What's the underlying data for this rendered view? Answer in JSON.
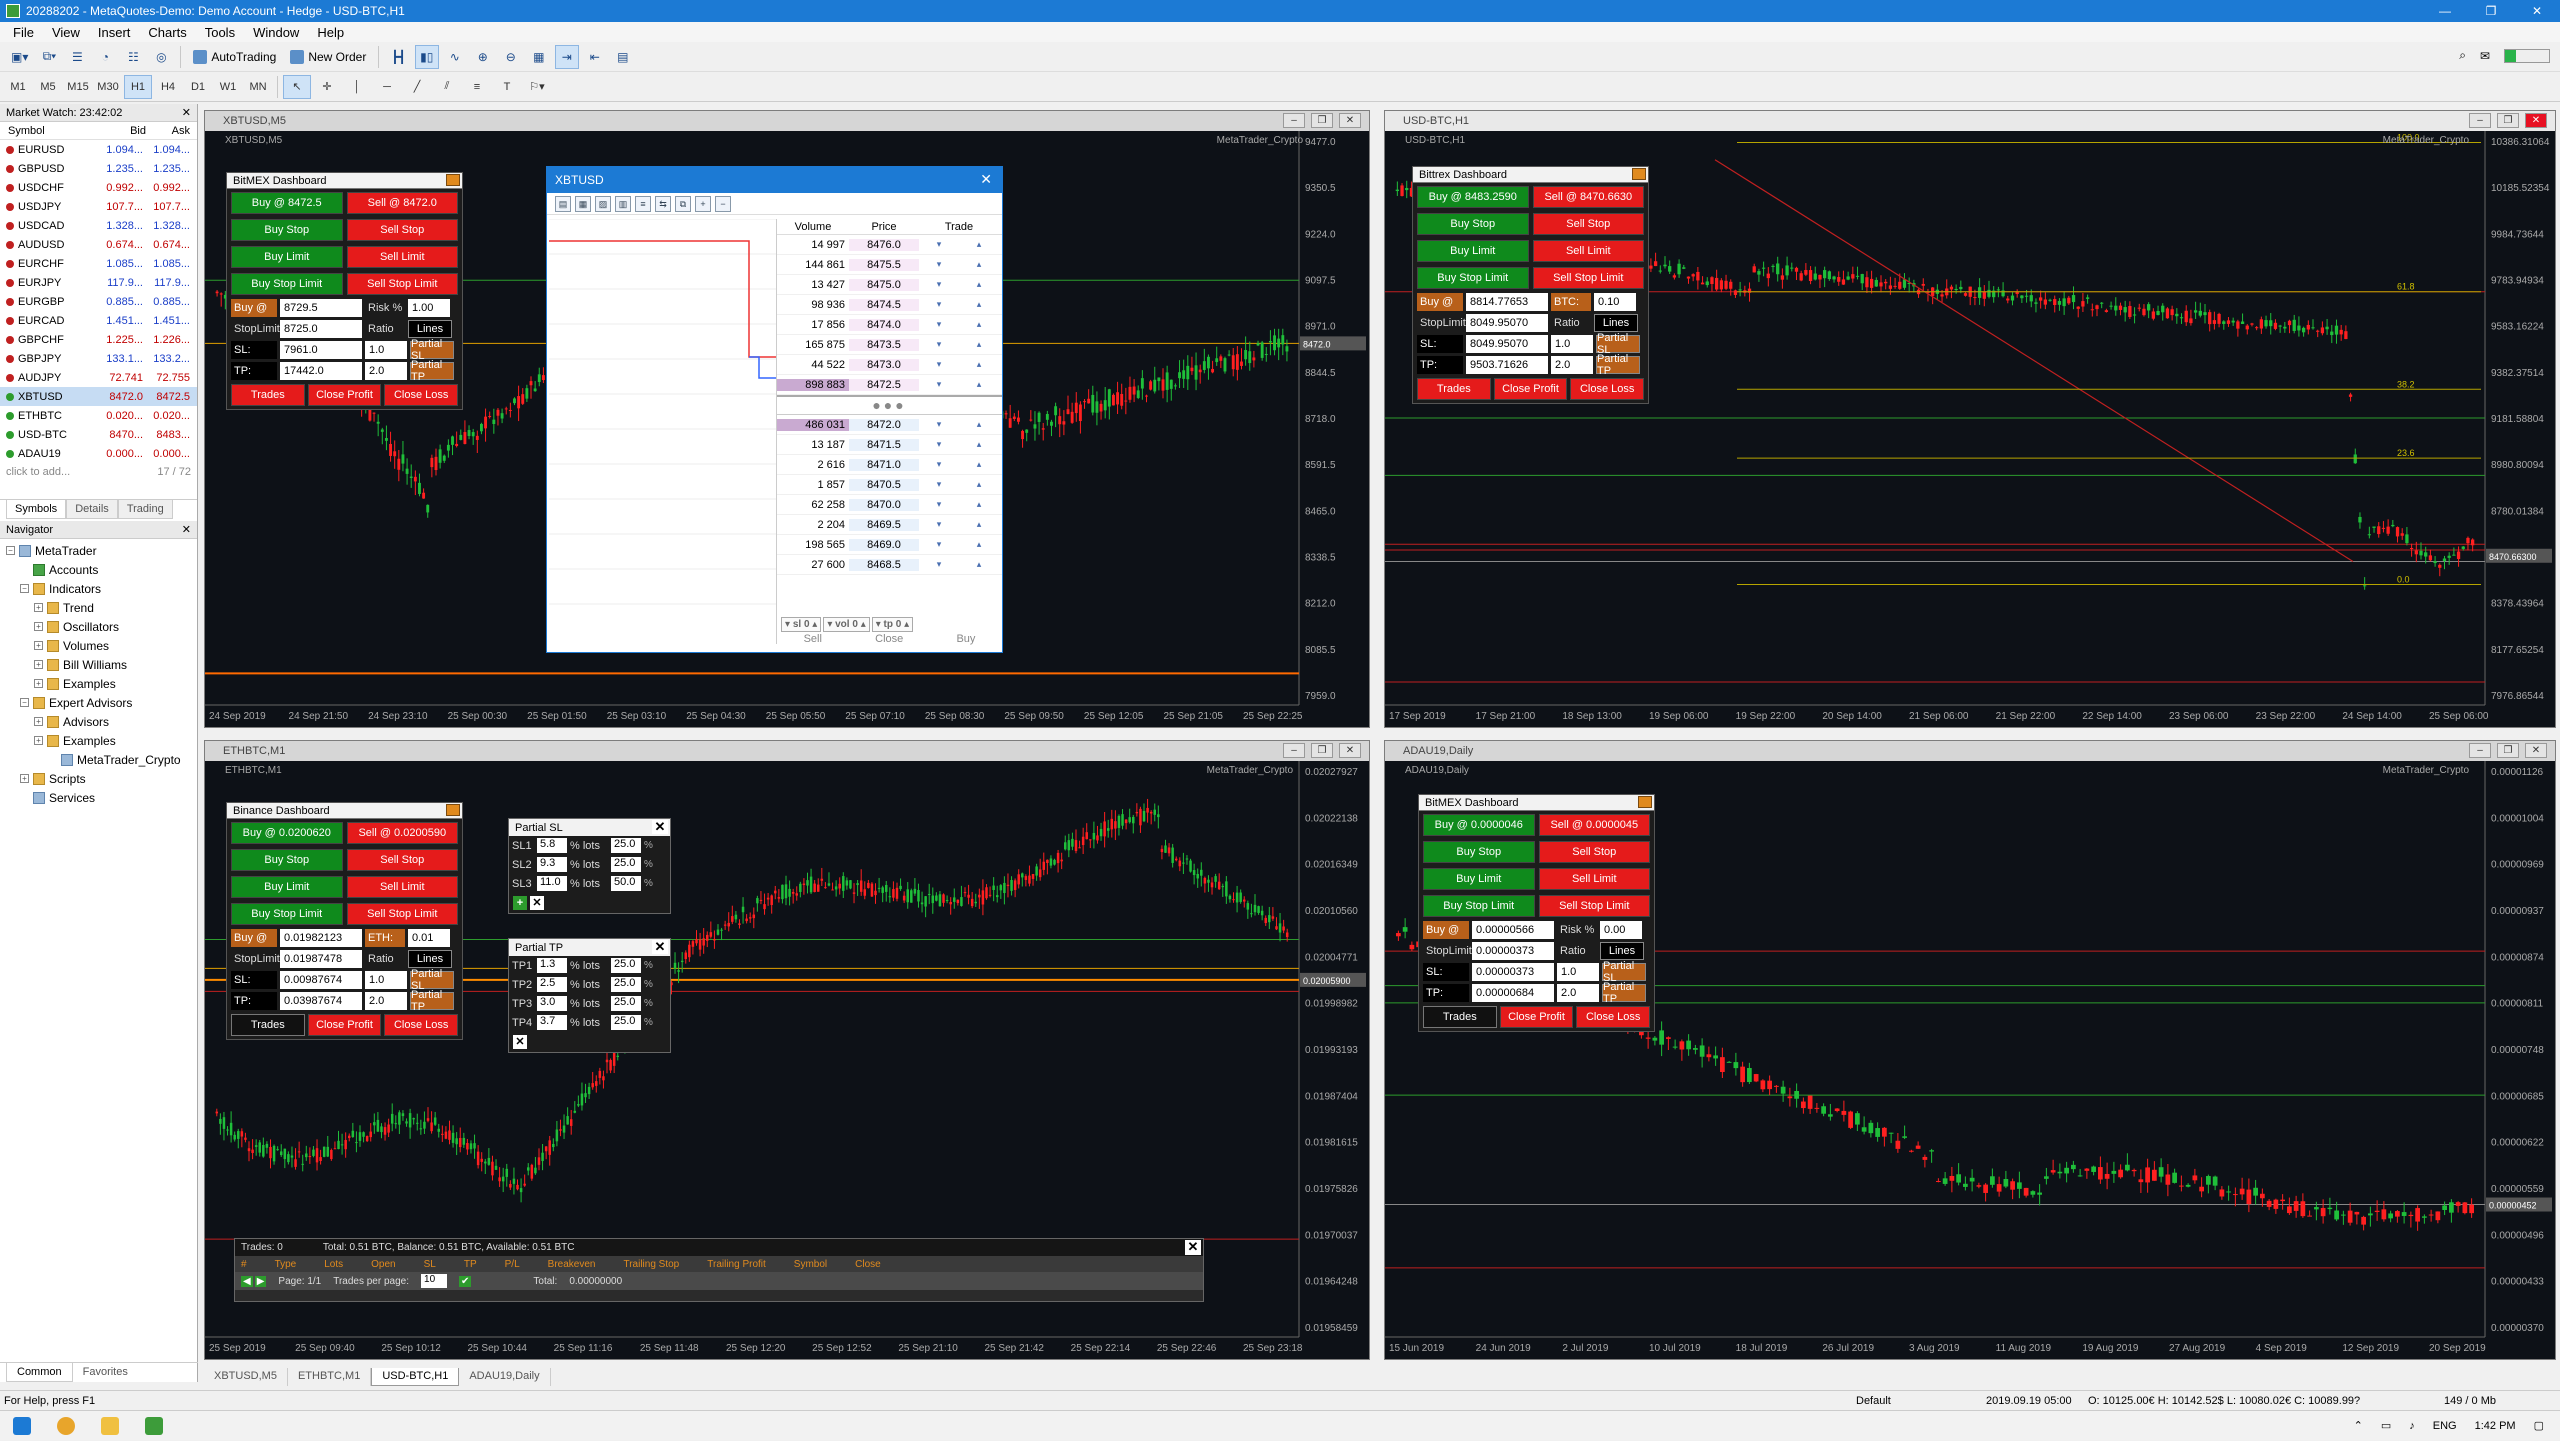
{
  "window": {
    "title": "20288202 - MetaQuotes-Demo: Demo Account - Hedge - USD-BTC,H1"
  },
  "menu": [
    "File",
    "View",
    "Insert",
    "Charts",
    "Tools",
    "Window",
    "Help"
  ],
  "toolbar": {
    "autotrading": "AutoTrading",
    "new_order": "New Order"
  },
  "timeframes": [
    "M1",
    "M5",
    "M15",
    "M30",
    "H1",
    "H4",
    "D1",
    "W1",
    "MN"
  ],
  "market_watch": {
    "title": "Market Watch: 23:42:02",
    "cols": [
      "Symbol",
      "Bid",
      "Ask"
    ],
    "rows": [
      {
        "s": "EURUSD",
        "b": "1.094...",
        "a": "1.094..."
      },
      {
        "s": "GBPUSD",
        "b": "1.235...",
        "a": "1.235..."
      },
      {
        "s": "USDCHF",
        "b": "0.992...",
        "a": "0.992..."
      },
      {
        "s": "USDJPY",
        "b": "107.7...",
        "a": "107.7..."
      },
      {
        "s": "USDCAD",
        "b": "1.328...",
        "a": "1.328..."
      },
      {
        "s": "AUDUSD",
        "b": "0.674...",
        "a": "0.674..."
      },
      {
        "s": "EURCHF",
        "b": "1.085...",
        "a": "1.085..."
      },
      {
        "s": "EURJPY",
        "b": "117.9...",
        "a": "117.9..."
      },
      {
        "s": "EURGBP",
        "b": "0.885...",
        "a": "0.885..."
      },
      {
        "s": "EURCAD",
        "b": "1.451...",
        "a": "1.451..."
      },
      {
        "s": "GBPCHF",
        "b": "1.225...",
        "a": "1.226..."
      },
      {
        "s": "GBPJPY",
        "b": "133.1...",
        "a": "133.2..."
      },
      {
        "s": "AUDJPY",
        "b": "72.741",
        "a": "72.755"
      },
      {
        "s": "XBTUSD",
        "b": "8472.0",
        "a": "8472.5"
      },
      {
        "s": "ETHBTC",
        "b": "0.020...",
        "a": "0.020..."
      },
      {
        "s": "USD-BTC",
        "b": "8470...",
        "a": "8483..."
      },
      {
        "s": "ADAU19",
        "b": "0.000...",
        "a": "0.000..."
      }
    ],
    "add": "click to add...",
    "count": "17 / 72",
    "tabs": [
      "Symbols",
      "Details",
      "Trading"
    ]
  },
  "navigator": {
    "title": "Navigator",
    "items": [
      "MetaTrader",
      "Accounts",
      "Indicators",
      "Trend",
      "Oscillators",
      "Volumes",
      "Bill Williams",
      "Examples",
      "Expert Advisors",
      "Advisors",
      "Examples",
      "MetaTrader_Crypto",
      "Scripts",
      "Services"
    ],
    "tabs": [
      "Common",
      "Favorites"
    ]
  },
  "charts": [
    {
      "id": "XBTUSD,M5",
      "sub": "XBTUSD,M5",
      "brand": "MetaTrader_Crypto",
      "prices": [
        "9477.0",
        "9350.5",
        "9224.0",
        "9097.5",
        "8971.0",
        "8844.5",
        "8718.0",
        "8591.5",
        "8465.0",
        "8338.5",
        "8212.0",
        "8085.5",
        "7959.0"
      ],
      "times": [
        "24 Sep 2019",
        "24 Sep 21:50",
        "24 Sep 23:10",
        "25 Sep 00:30",
        "25 Sep 01:50",
        "25 Sep 03:10",
        "25 Sep 04:30",
        "25 Sep 05:50",
        "25 Sep 07:10",
        "25 Sep 08:30",
        "25 Sep 09:50",
        "25 Sep 12:05",
        "25 Sep 21:05",
        "25 Sep 22:25"
      ],
      "price_tag": "8472.0"
    },
    {
      "id": "USD-BTC,H1",
      "sub": "USD-BTC,H1",
      "brand": "MetaTrader_Crypto",
      "prices": [
        "10386.31064",
        "10185.52354",
        "9984.73644",
        "9783.94934",
        "9583.16224",
        "9382.37514",
        "9181.58804",
        "8980.80094",
        "8780.01384",
        "8579.22674",
        "8378.43964",
        "8177.65254",
        "7976.86544"
      ],
      "times": [
        "17 Sep 2019",
        "17 Sep 21:00",
        "18 Sep 13:00",
        "19 Sep 06:00",
        "19 Sep 22:00",
        "20 Sep 14:00",
        "21 Sep 06:00",
        "21 Sep 22:00",
        "22 Sep 14:00",
        "23 Sep 06:00",
        "23 Sep 22:00",
        "24 Sep 14:00",
        "25 Sep 06:00"
      ],
      "fib": [
        "100.0",
        "61.8",
        "38.2",
        "23.6",
        "0.0"
      ],
      "price_tag": "8470.66300"
    },
    {
      "id": "ETHBTC,M1",
      "sub": "ETHBTC,M1",
      "brand": "MetaTrader_Crypto",
      "prices": [
        "0.02027927",
        "0.02022138",
        "0.02016349",
        "0.02010560",
        "0.02004771",
        "0.01998982",
        "0.01993193",
        "0.01987404",
        "0.01981615",
        "0.01975826",
        "0.01970037",
        "0.01964248",
        "0.01958459"
      ],
      "times": [
        "25 Sep 2019",
        "25 Sep 09:40",
        "25 Sep 10:12",
        "25 Sep 10:44",
        "25 Sep 11:16",
        "25 Sep 11:48",
        "25 Sep 12:20",
        "25 Sep 12:52",
        "25 Sep 21:10",
        "25 Sep 21:42",
        "25 Sep 22:14",
        "25 Sep 22:46",
        "25 Sep 23:18"
      ],
      "price_tag": "0.02005900"
    },
    {
      "id": "ADAU19,Daily",
      "sub": "ADAU19,Daily",
      "brand": "MetaTrader_Crypto",
      "prices": [
        "0.00001126",
        "0.00001004",
        "0.00000969",
        "0.00000937",
        "0.00000874",
        "0.00000811",
        "0.00000748",
        "0.00000685",
        "0.00000622",
        "0.00000559",
        "0.00000496",
        "0.00000433",
        "0.00000370"
      ],
      "times": [
        "15 Jun 2019",
        "24 Jun 2019",
        "2 Jul 2019",
        "10 Jul 2019",
        "18 Jul 2019",
        "26 Jul 2019",
        "3 Aug 2019",
        "11 Aug 2019",
        "19 Aug 2019",
        "27 Aug 2019",
        "4 Sep 2019",
        "12 Sep 2019",
        "20 Sep 2019"
      ],
      "price_tag": "0.00000452"
    }
  ],
  "dashboards": [
    {
      "title": "BitMEX Dashboard",
      "buy": "Buy @ 8472.5",
      "sell": "Sell @ 8472.0",
      "buy_stop": "Buy Stop",
      "sell_stop": "Sell Stop",
      "buy_limit": "Buy Limit",
      "sell_limit": "Sell Limit",
      "buy_stop_limit": "Buy Stop Limit",
      "sell_stop_limit": "Sell Stop Limit",
      "buy_at": "Buy @",
      "buy_at_val": "8729.5",
      "risk_lbl": "Risk %",
      "risk_val": "1.00",
      "stoplimit_lbl": "StopLimit",
      "stoplimit_val": "8725.0",
      "ratio": "Ratio",
      "lines": "Lines",
      "sl_lbl": "SL:",
      "sl_val": "7961.0",
      "sl_r": "1.0",
      "partial_sl": "Partial SL",
      "tp_lbl": "TP:",
      "tp_val": "17442.0",
      "tp_r": "2.0",
      "partial_tp": "Partial TP",
      "trades": "Trades",
      "close_profit": "Close Profit",
      "close_loss": "Close Loss"
    },
    {
      "title": "Bittrex Dashboard",
      "buy": "Buy @ 8483.2590",
      "sell": "Sell @ 8470.6630",
      "buy_stop": "Buy Stop",
      "sell_stop": "Sell Stop",
      "buy_limit": "Buy Limit",
      "sell_limit": "Sell Limit",
      "buy_stop_limit": "Buy Stop Limit",
      "sell_stop_limit": "Sell Stop Limit",
      "buy_at": "Buy @",
      "buy_at_val": "8814.77653",
      "risk_lbl": "BTC:",
      "risk_val": "0.10",
      "stoplimit_lbl": "StopLimit",
      "stoplimit_val": "8049.95070",
      "ratio": "Ratio",
      "lines": "Lines",
      "sl_lbl": "SL:",
      "sl_val": "8049.95070",
      "sl_r": "1.0",
      "partial_sl": "Partial SL",
      "tp_lbl": "TP:",
      "tp_val": "9503.71626",
      "tp_r": "2.0",
      "partial_tp": "Partial TP",
      "trades": "Trades",
      "close_profit": "Close Profit",
      "close_loss": "Close Loss"
    },
    {
      "title": "Binance Dashboard",
      "buy": "Buy @ 0.0200620",
      "sell": "Sell @ 0.0200590",
      "buy_stop": "Buy Stop",
      "sell_stop": "Sell Stop",
      "buy_limit": "Buy Limit",
      "sell_limit": "Sell Limit",
      "buy_stop_limit": "Buy Stop Limit",
      "sell_stop_limit": "Sell Stop Limit",
      "buy_at": "Buy @",
      "buy_at_val": "0.01982123",
      "risk_lbl": "ETH:",
      "risk_val": "0.01",
      "stoplimit_lbl": "StopLimit",
      "stoplimit_val": "0.01987478",
      "ratio": "Ratio",
      "lines": "Lines",
      "sl_lbl": "SL:",
      "sl_val": "0.00987674",
      "sl_r": "1.0",
      "partial_sl": "Partial SL",
      "tp_lbl": "TP:",
      "tp_val": "0.03987674",
      "tp_r": "2.0",
      "partial_tp": "Partial TP",
      "trades": "Trades",
      "close_profit": "Close Profit",
      "close_loss": "Close Loss"
    },
    {
      "title": "BitMEX Dashboard",
      "buy": "Buy @ 0.0000046",
      "sell": "Sell @ 0.0000045",
      "buy_stop": "Buy Stop",
      "sell_stop": "Sell Stop",
      "buy_limit": "Buy Limit",
      "sell_limit": "Sell Limit",
      "buy_stop_limit": "Buy Stop Limit",
      "sell_stop_limit": "Sell Stop Limit",
      "buy_at": "Buy @",
      "buy_at_val": "0.00000566",
      "risk_lbl": "Risk %",
      "risk_val": "0.00",
      "stoplimit_lbl": "StopLimit",
      "stoplimit_val": "0.00000373",
      "ratio": "Ratio",
      "lines": "Lines",
      "sl_lbl": "SL:",
      "sl_val": "0.00000373",
      "sl_r": "1.0",
      "partial_sl": "Partial SL",
      "tp_lbl": "TP:",
      "tp_val": "0.00000684",
      "tp_r": "2.0",
      "partial_tp": "Partial TP",
      "trades": "Trades",
      "close_profit": "Close Profit",
      "close_loss": "Close Loss"
    }
  ],
  "depth": {
    "title": "XBTUSD",
    "cols": [
      "Volume",
      "Price",
      "Trade"
    ],
    "asks": [
      [
        "14 997",
        "8476.0"
      ],
      [
        "144 861",
        "8475.5"
      ],
      [
        "13 427",
        "8475.0"
      ],
      [
        "98 936",
        "8474.5"
      ],
      [
        "17 856",
        "8474.0"
      ],
      [
        "165 875",
        "8473.5"
      ],
      [
        "44 522",
        "8473.0"
      ],
      [
        "898 883",
        "8472.5"
      ]
    ],
    "bids": [
      [
        "486 031",
        "8472.0"
      ],
      [
        "13 187",
        "8471.5"
      ],
      [
        "2 616",
        "8471.0"
      ],
      [
        "1 857",
        "8470.5"
      ],
      [
        "62 258",
        "8470.0"
      ],
      [
        "2 204",
        "8469.5"
      ],
      [
        "198 565",
        "8469.0"
      ],
      [
        "27 600",
        "8468.5"
      ]
    ],
    "ctrl": [
      "sl",
      "0",
      "vol",
      "0",
      "tp",
      "0"
    ],
    "actions": [
      "Sell",
      "Close",
      "Buy"
    ]
  },
  "partial_sl": {
    "title": "Partial SL",
    "rows": [
      [
        "SL1",
        "5.8",
        "25.0"
      ],
      [
        "SL2",
        "9.3",
        "25.0"
      ],
      [
        "SL3",
        "11.0",
        "50.0"
      ]
    ],
    "unit": "% lots"
  },
  "partial_tp": {
    "title": "Partial TP",
    "rows": [
      [
        "TP1",
        "1.3",
        "25.0"
      ],
      [
        "TP2",
        "2.5",
        "25.0"
      ],
      [
        "TP3",
        "3.0",
        "25.0"
      ],
      [
        "TP4",
        "3.7",
        "25.0"
      ]
    ],
    "unit": "% lots"
  },
  "trades_panel": {
    "header": [
      "Trades: 0",
      "Total: 0.51 BTC, Balance: 0.51 BTC, Available: 0.51 BTC"
    ],
    "cols": [
      "#",
      "Type",
      "Lots",
      "Open",
      "SL",
      "TP",
      "P/L",
      "Breakeven",
      "Trailing Stop",
      "Trailing Profit",
      "Symbol",
      "Close"
    ],
    "page": "Page: 1/1",
    "per_page": "Trades per page:",
    "per_page_val": "10",
    "total": "Total:",
    "total_val": "0.00000000"
  },
  "chart_tabs": [
    "XBTUSD,M5",
    "ETHBTC,M1",
    "USD-BTC,H1",
    "ADAU19,Daily"
  ],
  "status": {
    "help": "For Help, press F1",
    "profile": "Default",
    "datetime": "2019.09.19 05:00",
    "ohlc": "O: 10125.00€ H: 10142.52$ L: 10080.02€ C: 10089.99?",
    "mem": "149 / 0 Mb"
  },
  "taskbar": {
    "lang": "ENG",
    "time": "1:42 PM"
  }
}
